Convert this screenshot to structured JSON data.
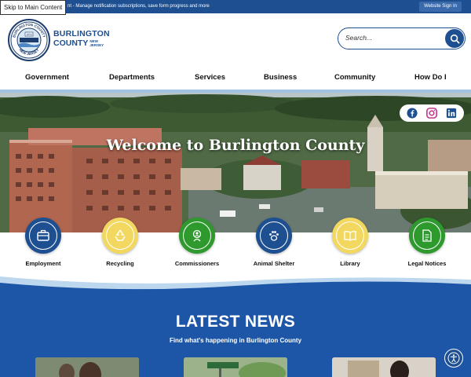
{
  "topbar": {
    "skip_link": "Skip to Main Content",
    "notice": "nt - Manage notification subscriptions, save form progress and more",
    "sign_in": "Website Sign In"
  },
  "logo": {
    "line1": "BURLINGTON",
    "line2": "COUNTY",
    "state_top": "NEW",
    "state_bottom": "JERSEY",
    "seal_top": "BURLINGTON COUNTY",
    "seal_bottom": "NEW JERSEY",
    "seal_year": "1694"
  },
  "search": {
    "placeholder": "Search..."
  },
  "nav": {
    "items": [
      "Government",
      "Departments",
      "Services",
      "Business",
      "Community",
      "How Do I"
    ]
  },
  "hero": {
    "title": "Welcome to Burlington County",
    "social": [
      "facebook-icon",
      "instagram-icon",
      "linkedin-icon"
    ]
  },
  "quick_links": [
    {
      "label": "Employment",
      "icon": "briefcase-icon",
      "color": "#1d4f91"
    },
    {
      "label": "Recycling",
      "icon": "recycle-icon",
      "color": "#f2d860"
    },
    {
      "label": "Commissioners",
      "icon": "person-badge-icon",
      "color": "#2e9a2e"
    },
    {
      "label": "Animal Shelter",
      "icon": "paw-icon",
      "color": "#1d4f91"
    },
    {
      "label": "Library",
      "icon": "book-icon",
      "color": "#f2d860"
    },
    {
      "label": "Legal Notices",
      "icon": "document-icon",
      "color": "#2e9a2e"
    }
  ],
  "news": {
    "title": "LATEST NEWS",
    "subtitle": "Find what's happening in Burlington County"
  },
  "colors": {
    "brand": "#1d4f91",
    "news_bg": "#1d56a6",
    "stripe": "#9fc3e0"
  }
}
